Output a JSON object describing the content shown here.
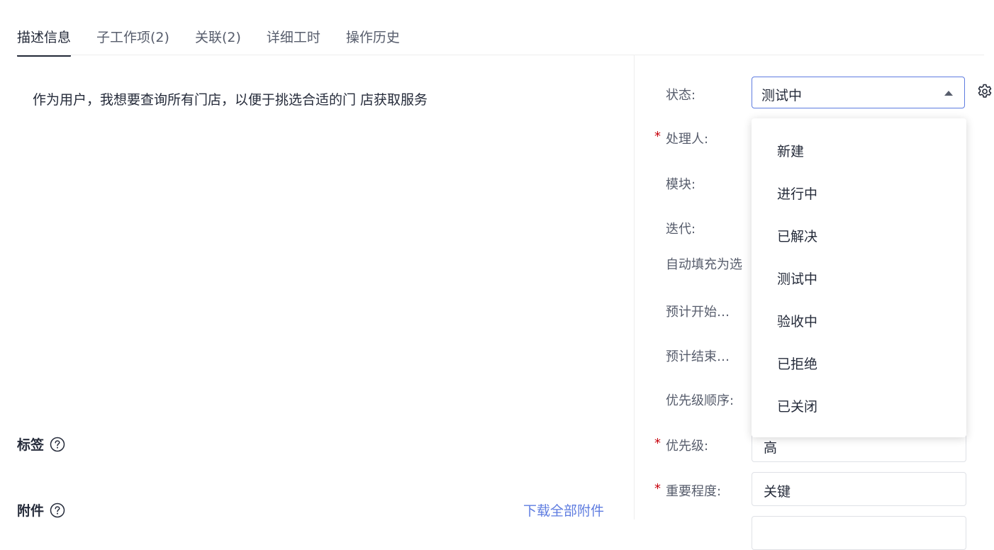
{
  "tabs": [
    {
      "label": "描述信息",
      "active": true
    },
    {
      "label": "子工作项(2)"
    },
    {
      "label": "关联(2)"
    },
    {
      "label": "详细工时"
    },
    {
      "label": "操作历史"
    }
  ],
  "description": "作为用户，我想要查询所有门店，以便于挑选合适的门 店获取服务",
  "sections": {
    "tags": "标签",
    "attachments": "附件",
    "download_all": "下载全部附件"
  },
  "fields": {
    "status_label": "状态:",
    "status_value": "测试中",
    "assignee_label": "处理人:",
    "module_label": "模块:",
    "iteration_label": "迭代:",
    "autofill_label": "自动填充为选",
    "planned_start_label": "预计开始…",
    "planned_end_label": "预计结束…",
    "priority_order_label": "优先级顺序:",
    "priority_label": "优先级:",
    "priority_value": "高",
    "importance_label": "重要程度:",
    "importance_value": "关键",
    "required_mark": "*"
  },
  "status_options": [
    "新建",
    "进行中",
    "已解决",
    "测试中",
    "验收中",
    "已拒绝",
    "已关闭"
  ],
  "colors": {
    "accent": "#5e7ce0",
    "required": "#c7000b",
    "text": "#252b3a",
    "muted": "#575d6c"
  },
  "icons": {
    "help": "question-circle",
    "settings": "gear",
    "caret": "caret-up"
  }
}
